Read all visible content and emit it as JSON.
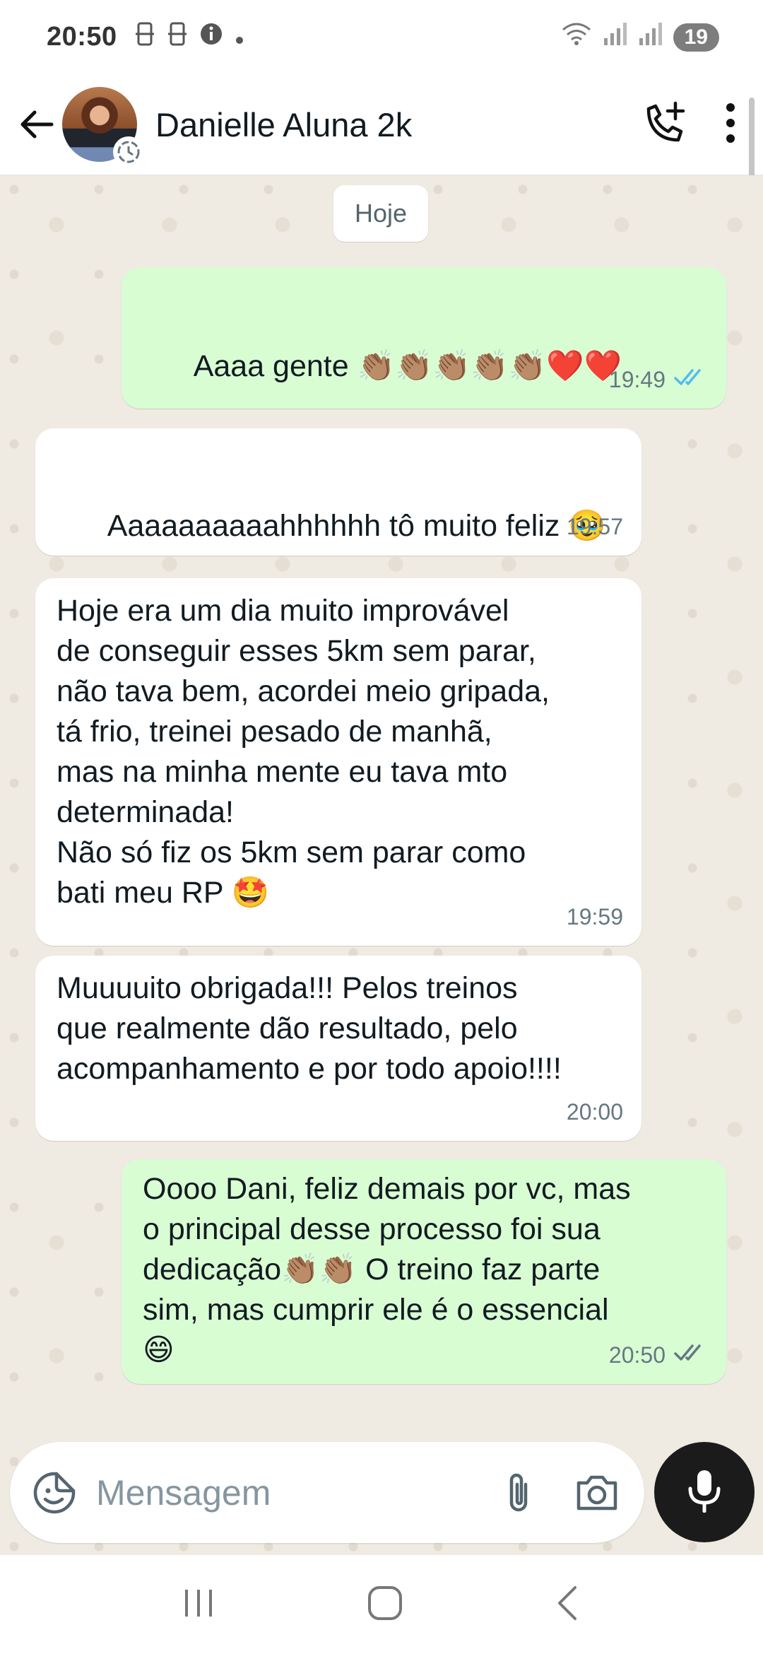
{
  "status_bar": {
    "time": "20:50",
    "battery": "19"
  },
  "header": {
    "contact_name": "Danielle Aluna 2k"
  },
  "chat": {
    "date_chip": "Hoje",
    "messages": [
      {
        "direction": "out",
        "text": "Aaaa gente 👏🏽👏🏽👏🏽👏🏽👏🏽❤️❤️",
        "text2": "❤️❤️👟👟👟👟👟",
        "time": "19:49",
        "status": "read"
      },
      {
        "direction": "in",
        "text": "Aaaaaaaaaahhhhhh tô muito feliz 🥹",
        "text2": "🥹🥹🥹",
        "time": "19:57"
      },
      {
        "direction": "in",
        "text": "Hoje era um dia muito improvável\nde conseguir esses 5km sem parar,\nnão tava bem, acordei meio gripada,\ntá frio, treinei pesado de manhã,\nmas na minha mente eu tava mto\ndeterminada!\nNão só fiz os 5km sem parar como\nbati meu RP 🤩",
        "time": "19:59"
      },
      {
        "direction": "in",
        "text": "Muuuuito obrigada!!! Pelos treinos\nque realmente dão resultado, pelo\nacompanhamento e por todo apoio!!!!",
        "time": "20:00"
      },
      {
        "direction": "out",
        "text": "Oooo Dani, feliz demais por vc, mas\no principal desse processo foi sua\ndedicação👏🏽👏🏽 O treino faz parte\nsim, mas cumprir ele é o essencial\n😄",
        "time": "20:50",
        "status": "delivered"
      }
    ]
  },
  "input": {
    "placeholder": "Mensagem"
  },
  "colors": {
    "outgoing_bubble": "#d9fdd3",
    "incoming_bubble": "#ffffff",
    "read_ticks": "#53bdeb",
    "chat_background": "#efeae2"
  }
}
